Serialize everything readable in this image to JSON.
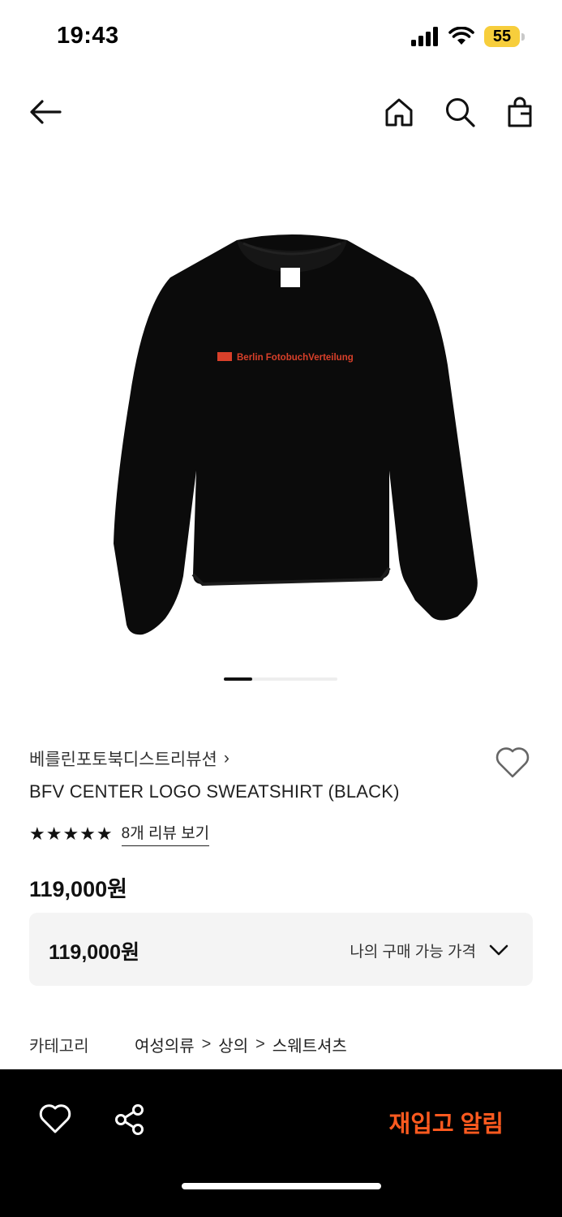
{
  "status_bar": {
    "time": "19:43",
    "battery_percent": "55",
    "icons": [
      "signal-icon",
      "wifi-icon",
      "battery-icon"
    ]
  },
  "nav": {
    "icons": [
      "back-arrow-icon",
      "home-icon",
      "search-icon",
      "shopping-bag-icon"
    ]
  },
  "product": {
    "image_print_text": "Berlin FotobuchVerteilung",
    "carousel": {
      "active_index": 1,
      "total_indicators": 4
    },
    "brand": "베를린포토북디스트리뷰션",
    "brand_chevron": "›",
    "name": "BFV CENTER LOGO SWEATSHIRT (BLACK)",
    "rating_stars": "★★★★★",
    "rating_value": 5,
    "review_link": "8개 리뷰 보기",
    "price": "119,000원"
  },
  "price_box": {
    "amount": "119,000원",
    "label": "나의 구매 가능 가격"
  },
  "category": {
    "label": "카테고리",
    "path": [
      "여성의류",
      "상의",
      "스웨트셔츠"
    ],
    "separator": ">"
  },
  "bottom_bar": {
    "restock_label": "재입고 알림"
  },
  "colors": {
    "accent": "#ff5a1f",
    "bottom_bar_bg": "#000000",
    "price_box_bg": "#f4f4f4",
    "battery": "#f7ce3c",
    "logo_print": "#d9402a"
  }
}
